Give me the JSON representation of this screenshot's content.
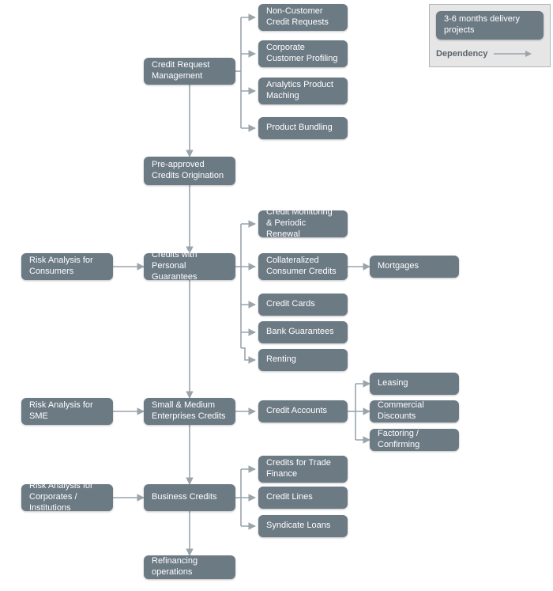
{
  "legend": {
    "node_label": "3-6 months delivery projects",
    "dependency_label": "Dependency"
  },
  "nodes": {
    "credit_request_mgmt": "Credit Request Management",
    "non_customer": "Non-Customer Credit Requests",
    "corp_profiling": "Corporate Customer Profiling",
    "analytics_prod": "Analytics Product Maching",
    "product_bundling": "Product Bundling",
    "pre_approved": "Pre-approved Credits Origination",
    "risk_consumers": "Risk Analysis for Consumers",
    "cred_personal": "Credits with Personal Guarantees",
    "credit_monitoring": "Credit Monitoring & Periodic Renewal",
    "collateralized": "Collateralized Consumer Credits",
    "mortgages": "Mortgages",
    "credit_cards": "Credit Cards",
    "bank_guarantees": "Bank Guarantees",
    "renting": "Renting",
    "risk_sme": "Risk Analysis for SME",
    "sme_credits": "Small & Medium Enterprises Credits",
    "credit_accounts": "Credit Accounts",
    "leasing": "Leasing",
    "commercial_discounts": "Commercial Discounts",
    "factoring": "Factoring / Confirming",
    "risk_corporates": "Risk Analysis for Corporates / Institutions",
    "business_credits": "Business Credits",
    "trade_finance": "Credits for Trade Finance",
    "credit_lines": "Credit Lines",
    "syndicate_loans": "Syndicate Loans",
    "refinancing": "Refinancing operations"
  }
}
